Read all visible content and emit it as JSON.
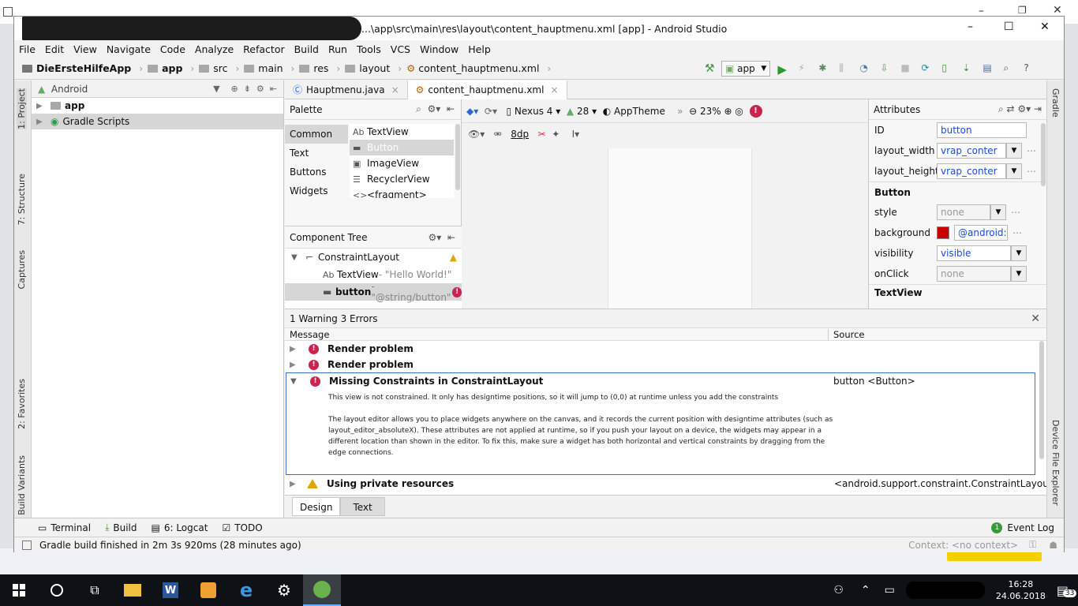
{
  "window": {
    "title": "...\\app\\src\\main\\res\\layout\\content_hauptmenu.xml [app] - Android Studio",
    "controls": [
      "–",
      "☐",
      "✕"
    ]
  },
  "menu": [
    "File",
    "Edit",
    "View",
    "Navigate",
    "Code",
    "Analyze",
    "Refactor",
    "Build",
    "Run",
    "Tools",
    "VCS",
    "Window",
    "Help"
  ],
  "breadcrumbs": [
    "DieErsteHilfeApp",
    "app",
    "src",
    "main",
    "res",
    "layout",
    "content_hauptmenu.xml"
  ],
  "toolbar": {
    "run_config": "app"
  },
  "project_panel": {
    "view_mode": "Android",
    "items": [
      {
        "label": "app"
      },
      {
        "label": "Gradle Scripts"
      }
    ]
  },
  "left_tool_tabs": [
    "1: Project",
    "7: Structure",
    "Captures",
    "2: Favorites",
    "Build Variants"
  ],
  "right_tool_tabs": [
    "Gradle",
    "Device File Explorer"
  ],
  "editor_tabs": [
    {
      "label": "Hauptmenu.java"
    },
    {
      "label": "content_hauptmenu.xml"
    }
  ],
  "palette": {
    "title": "Palette",
    "categories": [
      "Common",
      "Text",
      "Buttons",
      "Widgets"
    ],
    "widgets": [
      {
        "icon": "Ab",
        "label": "TextView"
      },
      {
        "icon": "▬",
        "label": "Button"
      },
      {
        "icon": "▣",
        "label": "ImageView"
      },
      {
        "icon": "☰",
        "label": "RecyclerView"
      },
      {
        "icon": "<>",
        "label": "<fragment>"
      }
    ]
  },
  "component_tree": {
    "title": "Component Tree",
    "items": [
      {
        "label": "ConstraintLayout",
        "extra": ""
      },
      {
        "label": "TextView",
        "extra": " - \"Hello World!\""
      },
      {
        "label": "button",
        "extra": " - \"@string/button\""
      }
    ]
  },
  "design_toolbar": {
    "device": "Nexus 4",
    "api": "28",
    "theme": "AppTheme",
    "zoom": "23%",
    "margin": "8dp"
  },
  "attributes": {
    "title": "Attributes",
    "id_label": "ID",
    "id_value": "button",
    "layout_width_label": "layout_width",
    "layout_width_value": "vrap_conter",
    "layout_height_label": "layout_height",
    "layout_height_value": "vrap_conter",
    "section_button": "Button",
    "style_label": "style",
    "style_value": "none",
    "background_label": "background",
    "background_value": "@android:c",
    "background_color": "#cc0000",
    "visibility_label": "visibility",
    "visibility_value": "visible",
    "onclick_label": "onClick",
    "onclick_value": "none",
    "section_textview": "TextView"
  },
  "problems": {
    "summary": "1 Warning 3 Errors",
    "col_message": "Message",
    "col_source": "Source",
    "items": [
      {
        "type": "error",
        "title": "Render problem",
        "source": ""
      },
      {
        "type": "error",
        "title": "Render problem",
        "source": ""
      },
      {
        "type": "error",
        "title": "Missing Constraints in ConstraintLayout",
        "source": "button <Button>"
      },
      {
        "type": "warning",
        "title": "Using private resources",
        "source": "<android.support.constraint.ConstraintLayout>"
      }
    ],
    "detail_line1": "This view is not constrained. It only has designtime positions, so it will jump to (0,0) at runtime unless you add the constraints",
    "detail_line2": "The layout editor allows you to place widgets anywhere on the canvas, and it records the current position with designtime attributes (such as",
    "detail_line3": "layout_editor_absoluteX). These attributes are not applied at runtime, so if you push your layout on a device, the widgets may appear in a",
    "detail_line4": "different location than shown in the editor. To fix this, make sure a widget has both horizontal and vertical constraints by dragging from the",
    "detail_line5": "edge connections."
  },
  "design_tabs": [
    "Design",
    "Text"
  ],
  "bottom_tools": [
    {
      "label": "Terminal"
    },
    {
      "label": "Build"
    },
    {
      "label": "6: Logcat"
    },
    {
      "label": "TODO"
    }
  ],
  "event_log": {
    "label": "Event Log",
    "count": "1"
  },
  "status": {
    "message": "Gradle build finished in 2m 3s 920ms (28 minutes ago)",
    "context": "Context: <no context>"
  },
  "taskbar": {
    "time": "16:28",
    "date": "24.06.2018",
    "notifications": "33"
  }
}
